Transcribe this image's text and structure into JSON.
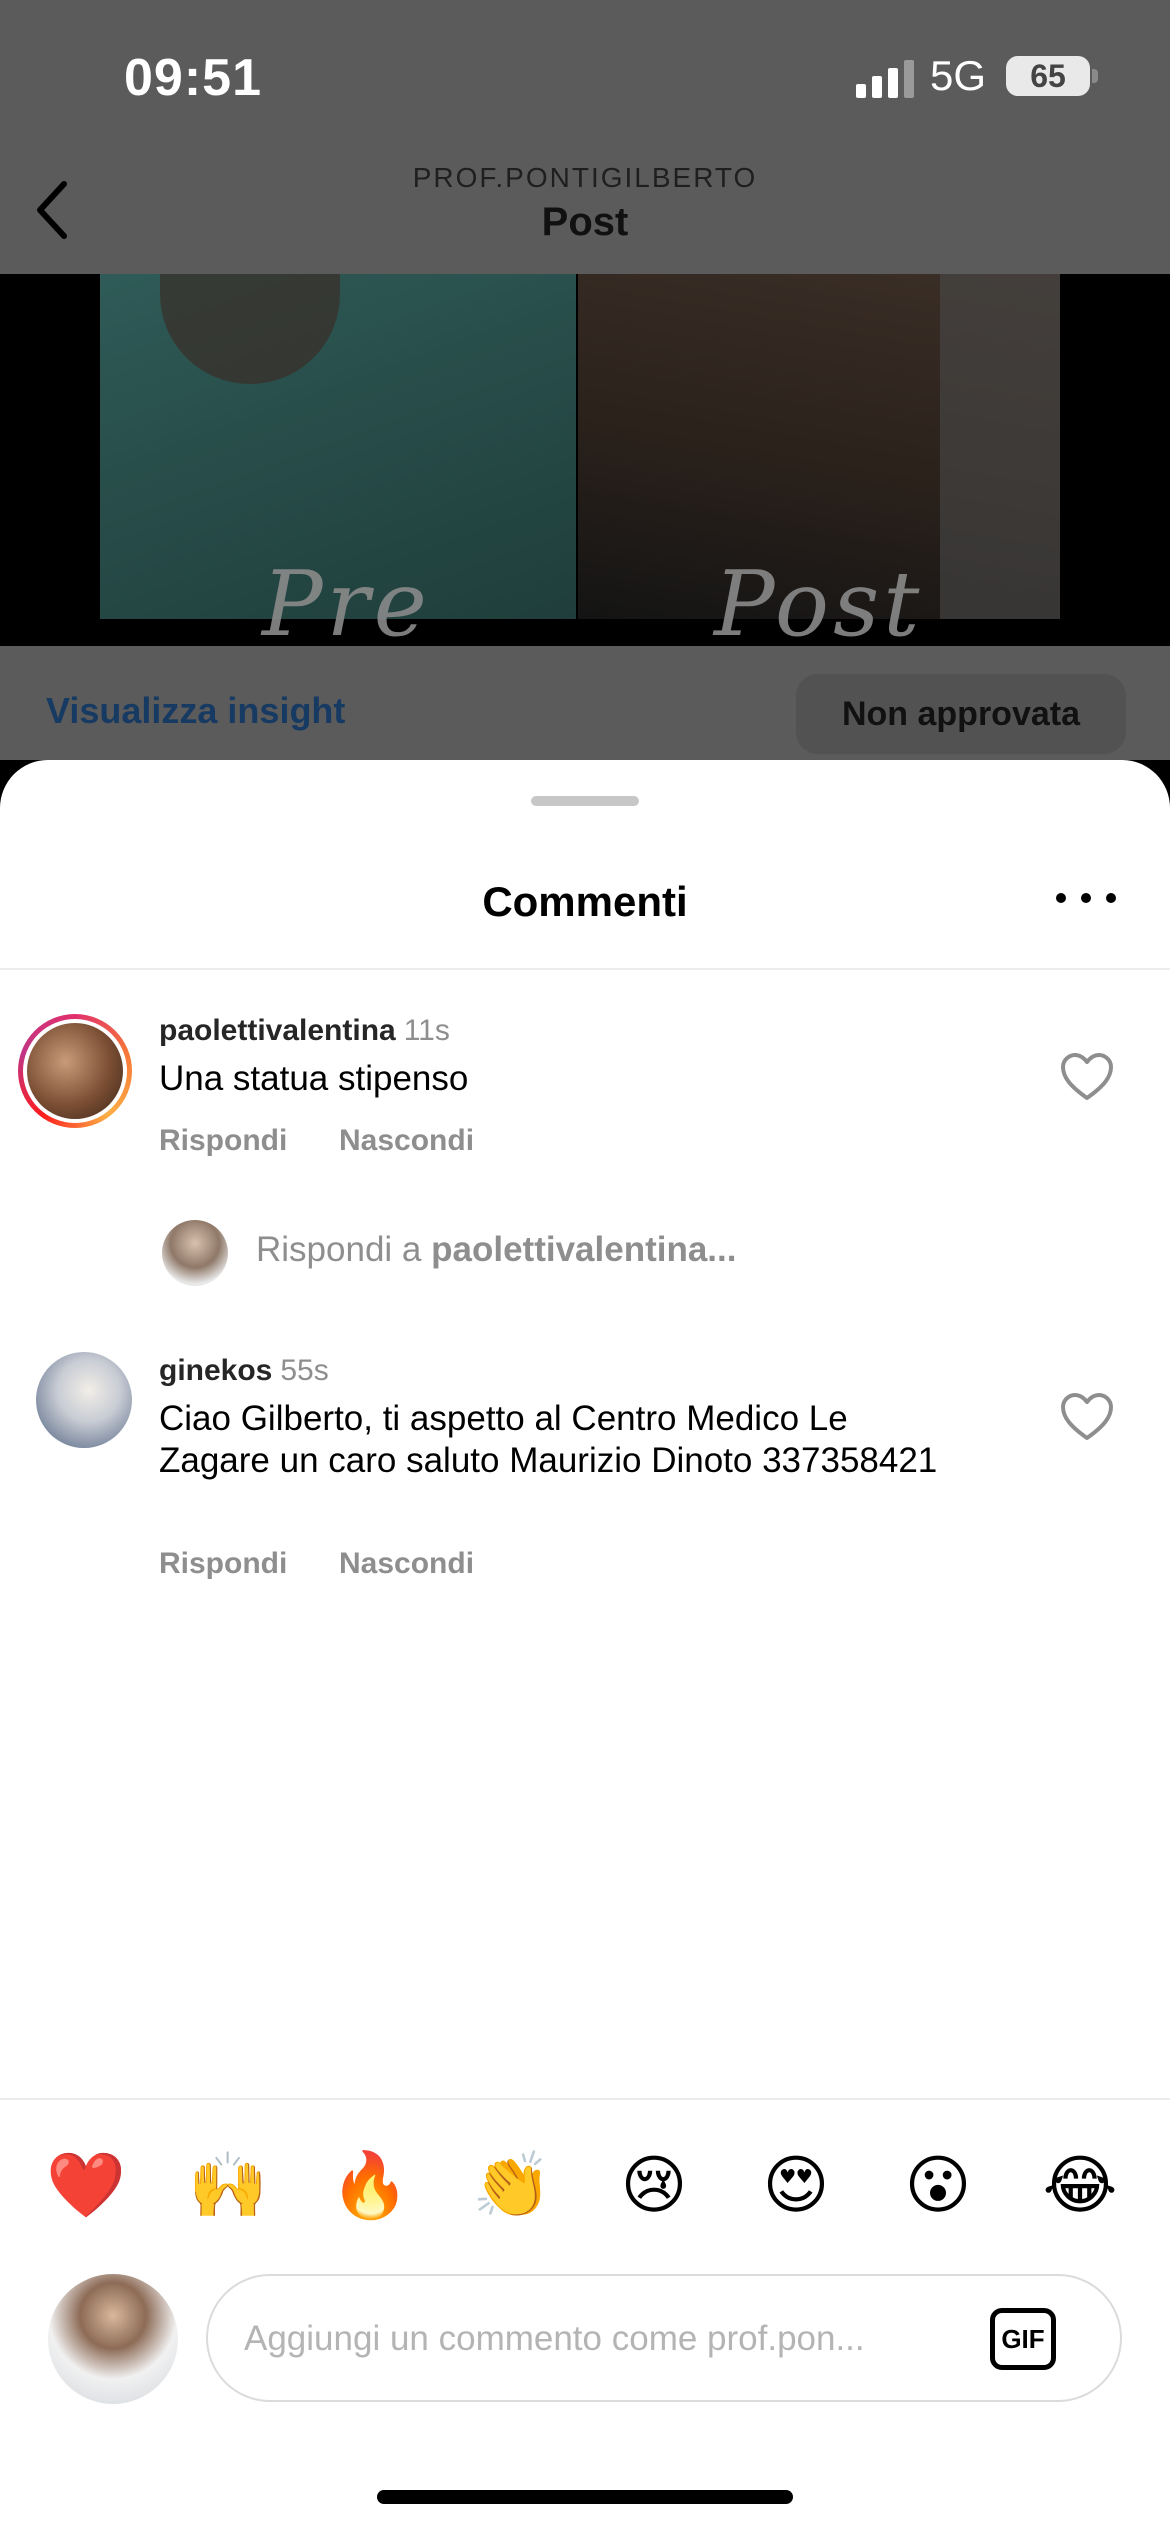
{
  "status_bar": {
    "time": "09:51",
    "network": "5G",
    "battery": "65"
  },
  "header": {
    "owner": "PROF.PONTIGILBERTO",
    "title": "Post"
  },
  "post": {
    "label_left": "Pre",
    "label_right": "Post",
    "insight_link": "Visualizza insight",
    "status": "Non approvata"
  },
  "sheet": {
    "title": "Commenti"
  },
  "comments": [
    {
      "username": "paolettivalentina",
      "time": "11s",
      "text": "Una statua stipenso",
      "reply_label": "Rispondi",
      "hide_label": "Nascondi"
    },
    {
      "username": "ginekos",
      "time": "55s",
      "text": "Ciao Gilberto, ti aspetto al Centro Medico Le Zagare un caro saluto Maurizio Dinoto 337358421",
      "reply_label": "Rispondi",
      "hide_label": "Nascondi"
    }
  ],
  "reply_prompt": {
    "prefix": "Rispondi a",
    "target": "paolettivalentina..."
  },
  "emojis": [
    "❤️",
    "🙌",
    "🔥",
    "👏",
    "😢",
    "😍",
    "😮",
    "😂"
  ],
  "composer": {
    "placeholder": "Aggiungi un commento come prof.pon...",
    "value": "",
    "gif_label": "GIF"
  },
  "colors": {
    "dim_overlay": "#5b5b5b",
    "link": "#173a63",
    "secondary_text": "#8e8e8e"
  }
}
